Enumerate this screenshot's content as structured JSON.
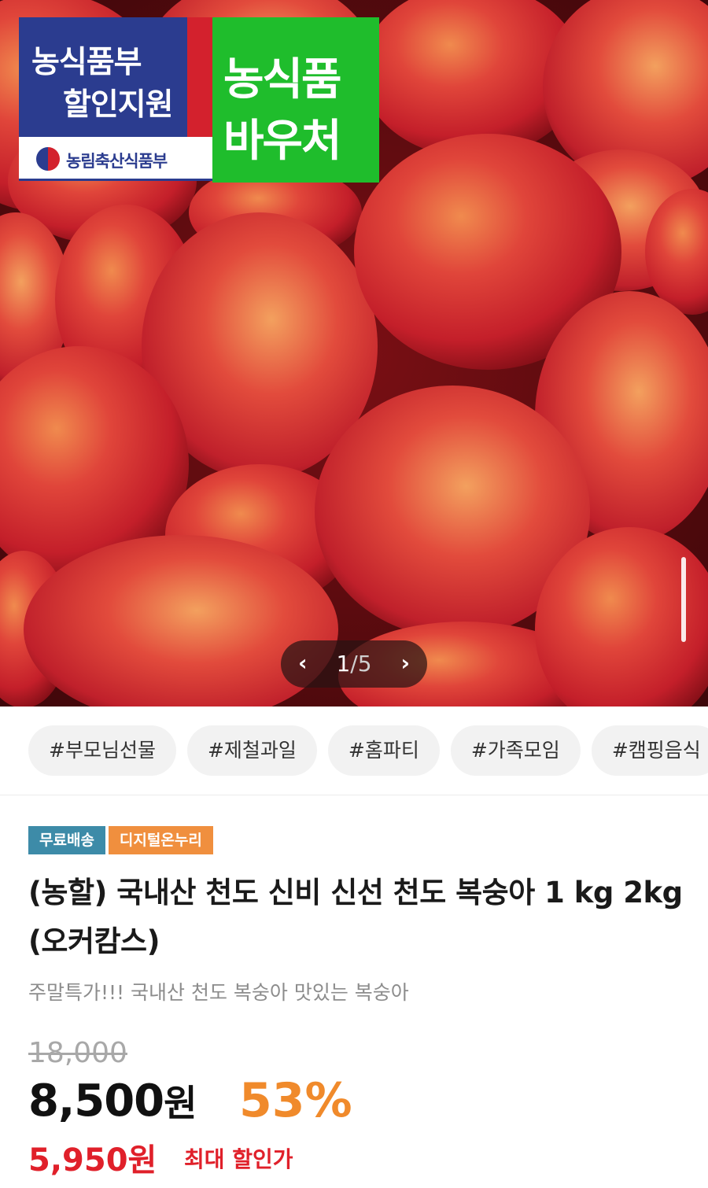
{
  "badge": {
    "blue_line1": "농식품부",
    "blue_line2": "할인지원",
    "ministry": "농림축산식품부",
    "green_line1": "농식품",
    "green_line2": "바우처"
  },
  "carousel": {
    "prev_icon": "chevron-left-icon",
    "next_icon": "chevron-right-icon",
    "current": "1",
    "separator": "/",
    "total": "5"
  },
  "tags": [
    "#부모님선물",
    "#제철과일",
    "#홈파티",
    "#가족모임",
    "#캠핑음식"
  ],
  "labels": {
    "shipping": "무료배송",
    "digital": "디지털온누리"
  },
  "product": {
    "title": "(농할) 국내산 천도 신비 신선 천도 복숭아 1 kg 2kg (오커캄스)",
    "subtitle": "주말특가!!! 국내산 천도 복숭아 맛있는 복숭아",
    "original_price": "18,000",
    "sale_price": "8,500",
    "sale_unit": "원",
    "discount": "53%",
    "max_discount_price": "5,950원",
    "max_discount_label": "최대 할인가"
  },
  "colors": {
    "ship_label": "#3d8ba8",
    "digital_label": "#f08f3e",
    "discount": "#f08a2b",
    "max_price": "#e0202a",
    "voucher_green": "#1fbd2c",
    "voucher_blue": "#2b3c8f"
  }
}
